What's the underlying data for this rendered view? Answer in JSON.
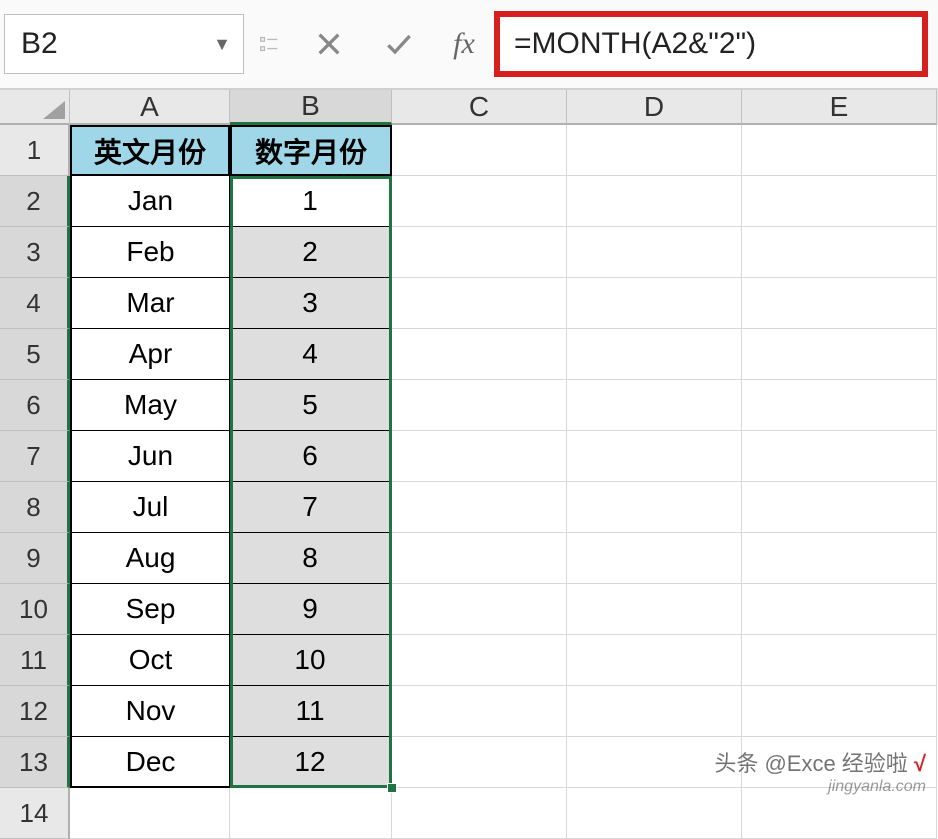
{
  "name_box": "B2",
  "formula": "=MONTH(A2&\"2\")",
  "fx_label": "fx",
  "columns": [
    "A",
    "B",
    "C",
    "D",
    "E"
  ],
  "rows": [
    "1",
    "2",
    "3",
    "4",
    "5",
    "6",
    "7",
    "8",
    "9",
    "10",
    "11",
    "12",
    "13",
    "14"
  ],
  "headers": {
    "A": "英文月份",
    "B": "数字月份"
  },
  "table": [
    {
      "a": "Jan",
      "b": "1"
    },
    {
      "a": "Feb",
      "b": "2"
    },
    {
      "a": "Mar",
      "b": "3"
    },
    {
      "a": "Apr",
      "b": "4"
    },
    {
      "a": "May",
      "b": "5"
    },
    {
      "a": "Jun",
      "b": "6"
    },
    {
      "a": "Jul",
      "b": "7"
    },
    {
      "a": "Aug",
      "b": "8"
    },
    {
      "a": "Sep",
      "b": "9"
    },
    {
      "a": "Oct",
      "b": "10"
    },
    {
      "a": "Nov",
      "b": "11"
    },
    {
      "a": "Dec",
      "b": "12"
    }
  ],
  "watermark": {
    "line1": "头条 @Exce 经验啦",
    "check": "√",
    "line2": "jingyanla.com"
  },
  "chart_data": {
    "type": "table",
    "title": "",
    "columns": [
      "英文月份",
      "数字月份"
    ],
    "rows": [
      [
        "Jan",
        1
      ],
      [
        "Feb",
        2
      ],
      [
        "Mar",
        3
      ],
      [
        "Apr",
        4
      ],
      [
        "May",
        5
      ],
      [
        "Jun",
        6
      ],
      [
        "Jul",
        7
      ],
      [
        "Aug",
        8
      ],
      [
        "Sep",
        9
      ],
      [
        "Oct",
        10
      ],
      [
        "Nov",
        11
      ],
      [
        "Dec",
        12
      ]
    ]
  }
}
